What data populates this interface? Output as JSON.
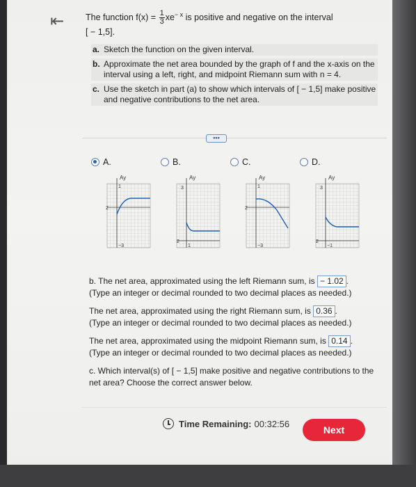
{
  "nav": {
    "back_icon": "back-to-start-icon",
    "back_glyph": "⇤"
  },
  "question": {
    "lead": "The function f(x) =",
    "frac_num": "1",
    "frac_den": "3",
    "expr_base": "xe",
    "expr_exp": "− x",
    "lead_tail": "is positive and negative on the interval",
    "interval": "[ − 1,5].",
    "parts": [
      {
        "label": "a.",
        "text": "Sketch the function on the given interval."
      },
      {
        "label": "b.",
        "text": "Approximate the net area bounded by the graph of f and the x-axis on the interval using a left, right, and midpoint Riemann sum with n = 4."
      },
      {
        "label": "c.",
        "text": "Use the sketch in part (a) to show which intervals of [ − 1,5] make positive and negative contributions to the net area."
      }
    ]
  },
  "more_button": "•••",
  "options": [
    {
      "label": "A.",
      "selected": true
    },
    {
      "label": "B.",
      "selected": false
    },
    {
      "label": "C.",
      "selected": false
    },
    {
      "label": "D.",
      "selected": false
    }
  ],
  "graphs": {
    "y_axis": "Ay",
    "a": {
      "top": "1",
      "mid": "2",
      "bottom": "−3"
    },
    "b": {
      "top": "3",
      "mid": "2",
      "bottom": "1"
    },
    "c": {
      "top": "1",
      "mid": "2",
      "bottom": "−3"
    },
    "d": {
      "top": "3",
      "mid": "2",
      "bottom": "−1"
    }
  },
  "answers": {
    "left_text": "b. The net area, approximated using the left Riemann sum, is",
    "left_value": "− 1.02",
    "left_hint": "(Type an integer or decimal rounded to two decimal places as needed.)",
    "right_text": "The net area, approximated using the right Riemann sum, is",
    "right_value": "0.36",
    "right_hint": "(Type an integer or decimal rounded to two decimal places as needed.)",
    "mid_text": "The net area, approximated using the midpoint Riemann sum, is",
    "mid_value": "0.14",
    "mid_hint": "(Type an integer or decimal rounded to two decimal places as needed.)",
    "c_text": "c. Which interval(s) of [ − 1,5] make positive and negative contributions to the net area? Choose the correct answer below."
  },
  "footer": {
    "timer_label": "Time Remaining:",
    "timer_value": "00:32:56",
    "next_label": "Next"
  }
}
